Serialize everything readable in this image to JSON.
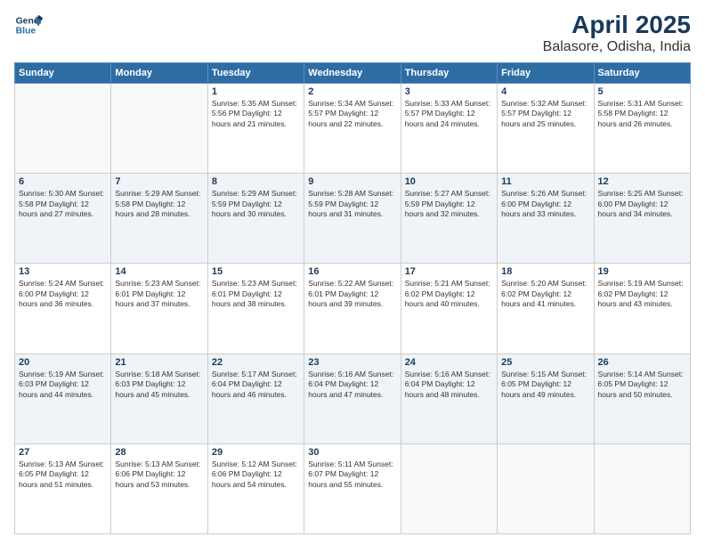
{
  "logo": {
    "line1": "General",
    "line2": "Blue"
  },
  "title": "April 2025",
  "subtitle": "Balasore, Odisha, India",
  "days_header": [
    "Sunday",
    "Monday",
    "Tuesday",
    "Wednesday",
    "Thursday",
    "Friday",
    "Saturday"
  ],
  "weeks": [
    [
      {
        "num": "",
        "text": ""
      },
      {
        "num": "",
        "text": ""
      },
      {
        "num": "1",
        "text": "Sunrise: 5:35 AM\nSunset: 5:56 PM\nDaylight: 12 hours\nand 21 minutes."
      },
      {
        "num": "2",
        "text": "Sunrise: 5:34 AM\nSunset: 5:57 PM\nDaylight: 12 hours\nand 22 minutes."
      },
      {
        "num": "3",
        "text": "Sunrise: 5:33 AM\nSunset: 5:57 PM\nDaylight: 12 hours\nand 24 minutes."
      },
      {
        "num": "4",
        "text": "Sunrise: 5:32 AM\nSunset: 5:57 PM\nDaylight: 12 hours\nand 25 minutes."
      },
      {
        "num": "5",
        "text": "Sunrise: 5:31 AM\nSunset: 5:58 PM\nDaylight: 12 hours\nand 26 minutes."
      }
    ],
    [
      {
        "num": "6",
        "text": "Sunrise: 5:30 AM\nSunset: 5:58 PM\nDaylight: 12 hours\nand 27 minutes."
      },
      {
        "num": "7",
        "text": "Sunrise: 5:29 AM\nSunset: 5:58 PM\nDaylight: 12 hours\nand 28 minutes."
      },
      {
        "num": "8",
        "text": "Sunrise: 5:29 AM\nSunset: 5:59 PM\nDaylight: 12 hours\nand 30 minutes."
      },
      {
        "num": "9",
        "text": "Sunrise: 5:28 AM\nSunset: 5:59 PM\nDaylight: 12 hours\nand 31 minutes."
      },
      {
        "num": "10",
        "text": "Sunrise: 5:27 AM\nSunset: 5:59 PM\nDaylight: 12 hours\nand 32 minutes."
      },
      {
        "num": "11",
        "text": "Sunrise: 5:26 AM\nSunset: 6:00 PM\nDaylight: 12 hours\nand 33 minutes."
      },
      {
        "num": "12",
        "text": "Sunrise: 5:25 AM\nSunset: 6:00 PM\nDaylight: 12 hours\nand 34 minutes."
      }
    ],
    [
      {
        "num": "13",
        "text": "Sunrise: 5:24 AM\nSunset: 6:00 PM\nDaylight: 12 hours\nand 36 minutes."
      },
      {
        "num": "14",
        "text": "Sunrise: 5:23 AM\nSunset: 6:01 PM\nDaylight: 12 hours\nand 37 minutes."
      },
      {
        "num": "15",
        "text": "Sunrise: 5:23 AM\nSunset: 6:01 PM\nDaylight: 12 hours\nand 38 minutes."
      },
      {
        "num": "16",
        "text": "Sunrise: 5:22 AM\nSunset: 6:01 PM\nDaylight: 12 hours\nand 39 minutes."
      },
      {
        "num": "17",
        "text": "Sunrise: 5:21 AM\nSunset: 6:02 PM\nDaylight: 12 hours\nand 40 minutes."
      },
      {
        "num": "18",
        "text": "Sunrise: 5:20 AM\nSunset: 6:02 PM\nDaylight: 12 hours\nand 41 minutes."
      },
      {
        "num": "19",
        "text": "Sunrise: 5:19 AM\nSunset: 6:02 PM\nDaylight: 12 hours\nand 43 minutes."
      }
    ],
    [
      {
        "num": "20",
        "text": "Sunrise: 5:19 AM\nSunset: 6:03 PM\nDaylight: 12 hours\nand 44 minutes."
      },
      {
        "num": "21",
        "text": "Sunrise: 5:18 AM\nSunset: 6:03 PM\nDaylight: 12 hours\nand 45 minutes."
      },
      {
        "num": "22",
        "text": "Sunrise: 5:17 AM\nSunset: 6:04 PM\nDaylight: 12 hours\nand 46 minutes."
      },
      {
        "num": "23",
        "text": "Sunrise: 5:16 AM\nSunset: 6:04 PM\nDaylight: 12 hours\nand 47 minutes."
      },
      {
        "num": "24",
        "text": "Sunrise: 5:16 AM\nSunset: 6:04 PM\nDaylight: 12 hours\nand 48 minutes."
      },
      {
        "num": "25",
        "text": "Sunrise: 5:15 AM\nSunset: 6:05 PM\nDaylight: 12 hours\nand 49 minutes."
      },
      {
        "num": "26",
        "text": "Sunrise: 5:14 AM\nSunset: 6:05 PM\nDaylight: 12 hours\nand 50 minutes."
      }
    ],
    [
      {
        "num": "27",
        "text": "Sunrise: 5:13 AM\nSunset: 6:05 PM\nDaylight: 12 hours\nand 51 minutes."
      },
      {
        "num": "28",
        "text": "Sunrise: 5:13 AM\nSunset: 6:06 PM\nDaylight: 12 hours\nand 53 minutes."
      },
      {
        "num": "29",
        "text": "Sunrise: 5:12 AM\nSunset: 6:06 PM\nDaylight: 12 hours\nand 54 minutes."
      },
      {
        "num": "30",
        "text": "Sunrise: 5:11 AM\nSunset: 6:07 PM\nDaylight: 12 hours\nand 55 minutes."
      },
      {
        "num": "",
        "text": ""
      },
      {
        "num": "",
        "text": ""
      },
      {
        "num": "",
        "text": ""
      }
    ]
  ]
}
